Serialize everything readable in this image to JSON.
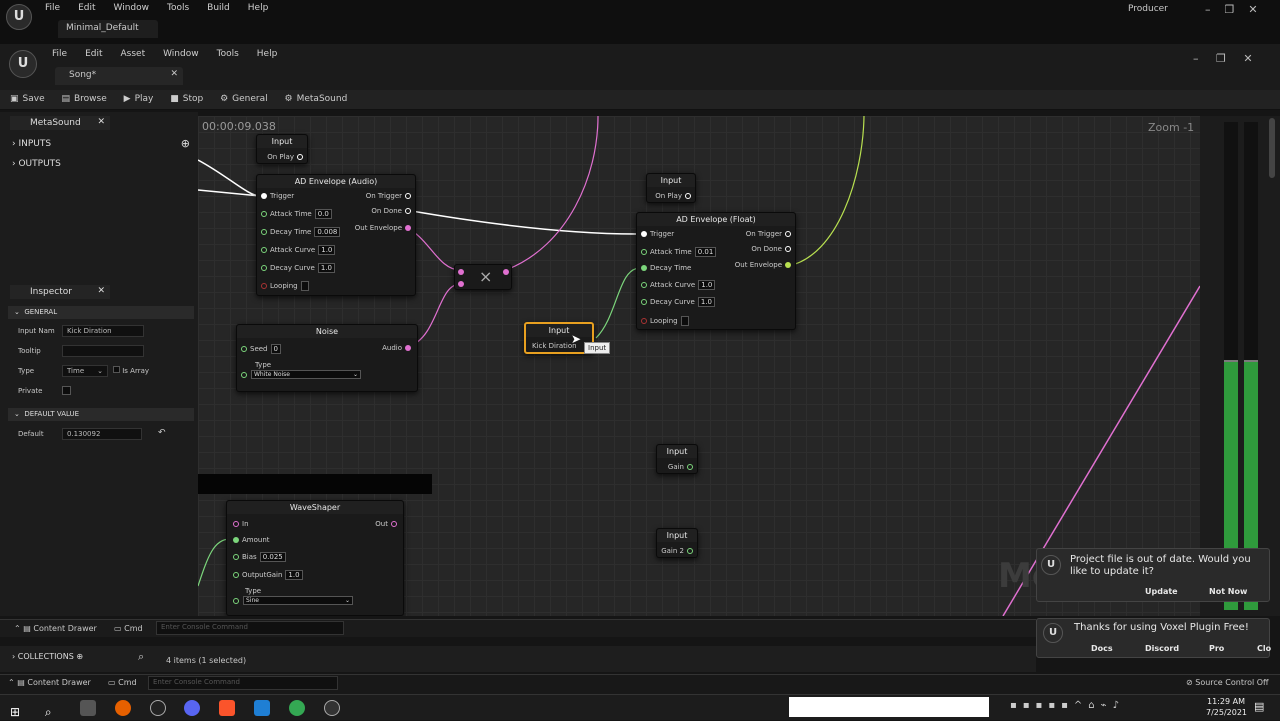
{
  "os_bar": {
    "menus": [
      "File",
      "Edit",
      "Window",
      "Tools",
      "Build",
      "Help"
    ],
    "project": "Minimal_Default",
    "user": "Producer"
  },
  "editor": {
    "menus": [
      "File",
      "Edit",
      "Asset",
      "Window",
      "Tools",
      "Help"
    ],
    "tab": "Song*"
  },
  "toolbar": {
    "save": "Save",
    "browse": "Browse",
    "play": "Play",
    "stop": "Stop",
    "general": "General",
    "metasound": "MetaSound"
  },
  "left_panel": {
    "tab": "MetaSound",
    "inputs": "INPUTS",
    "outputs": "OUTPUTS"
  },
  "inspector": {
    "tab": "Inspector",
    "section_general": "GENERAL",
    "input_name_label": "Input Nam",
    "input_name": "Kick Diration",
    "tooltip_label": "Tooltip",
    "type_label": "Type",
    "type_value": "Time",
    "is_array": "Is Array",
    "private_label": "Private",
    "section_default": "DEFAULT VALUE",
    "default_label": "Default",
    "default_value": "0.130092"
  },
  "graph": {
    "timer": "00:00:09.038",
    "zoom": "Zoom -1",
    "watermark": "Me",
    "n_input1": {
      "title": "Input",
      "pin": "On Play"
    },
    "n_adenv": {
      "title": "AD Envelope (Audio)",
      "trigger": "Trigger",
      "attack": "Attack Time",
      "attack_v": "0.0",
      "decay": "Decay Time",
      "decay_v": "0.008",
      "acurve": "Attack Curve",
      "acurve_v": "1.0",
      "dcurve": "Decay Curve",
      "dcurve_v": "1.0",
      "looping": "Looping",
      "on_trigger": "On Trigger",
      "on_done": "On Done",
      "out_env": "Out Envelope"
    },
    "n_mult": {
      "symbol": "×"
    },
    "n_noise": {
      "title": "Noise",
      "seed": "Seed",
      "seed_v": "0",
      "type": "Type",
      "type_v": "White Noise",
      "audio": "Audio"
    },
    "n_input2": {
      "title": "Input",
      "pin": "On Play"
    },
    "n_adfloat": {
      "title": "AD Envelope (Float)",
      "trigger": "Trigger",
      "attack": "Attack Time",
      "attack_v": "0.01",
      "decay": "Decay Time",
      "acurve": "Attack Curve",
      "acurve_v": "1.0",
      "dcurve": "Decay Curve",
      "dcurve_v": "1.0",
      "looping": "Looping",
      "on_trigger": "On Trigger",
      "on_done": "On Done",
      "out_env": "Out Envelope"
    },
    "n_kick": {
      "title": "Input",
      "pin": "Kick Diration",
      "tooltip": "Input"
    },
    "n_gain": {
      "title": "Input",
      "pin": "Gain"
    },
    "n_gain2": {
      "title": "Input",
      "pin": "Gain 2"
    },
    "n_wave": {
      "title": "WaveShaper",
      "in": "In",
      "out": "Out",
      "amount": "Amount",
      "bias": "Bias",
      "bias_v": "0.025",
      "outgain": "OutputGain",
      "outgain_v": "1.0",
      "type": "Type",
      "type_v": "Sine"
    }
  },
  "toasts": {
    "t1_text": "Project file is out of date. Would you like to update it?",
    "t1_update": "Update",
    "t1_notnow": "Not Now",
    "t2_text": "Thanks for using Voxel Plugin Free!",
    "t2_docs": "Docs",
    "t2_discord": "Discord",
    "t2_pro": "Pro",
    "t2_close": "Clo"
  },
  "bottom": {
    "content_drawer": "Content Drawer",
    "cmd": "Cmd",
    "console_ph": "Enter Console Command",
    "collections": "COLLECTIONS",
    "items": "4 items (1 selected)",
    "source_control": "Source Control Off"
  },
  "taskbar": {
    "time": "11:29 AM",
    "date": "7/25/2021"
  }
}
